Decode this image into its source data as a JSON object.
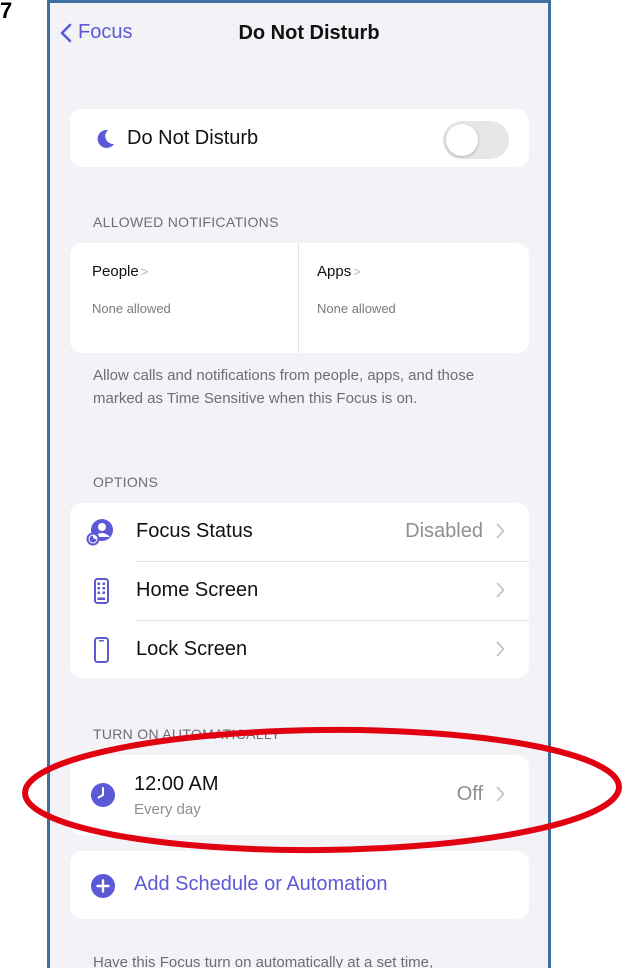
{
  "nav": {
    "back_label": "Focus",
    "title": "Do Not Disturb"
  },
  "dnd": {
    "label": "Do Not Disturb",
    "toggle_on": false
  },
  "allowed": {
    "header": "ALLOWED NOTIFICATIONS",
    "people_title": "People",
    "people_sub": "None allowed",
    "apps_title": "Apps",
    "apps_sub": "None allowed",
    "footnote": "Allow calls and notifications from people, apps, and those marked as Time Sensitive when this Focus is on."
  },
  "options": {
    "header": "OPTIONS",
    "items": [
      {
        "label": "Focus Status",
        "value": "Disabled",
        "icon": "focus-status-icon"
      },
      {
        "label": "Home Screen",
        "value": "",
        "icon": "home-screen-icon"
      },
      {
        "label": "Lock Screen",
        "value": "",
        "icon": "lock-screen-icon"
      }
    ]
  },
  "automation": {
    "header": "TURN ON AUTOMATICALLY",
    "schedule_time": "12:00 AM",
    "schedule_repeat": "Every day",
    "schedule_value": "Off",
    "add_label": "Add Schedule or Automation",
    "footnote": "Have this Focus turn on automatically at a set time,"
  },
  "colors": {
    "accent": "#5b59d6",
    "background": "#f2f2f7",
    "annotation": "#e0000f"
  }
}
